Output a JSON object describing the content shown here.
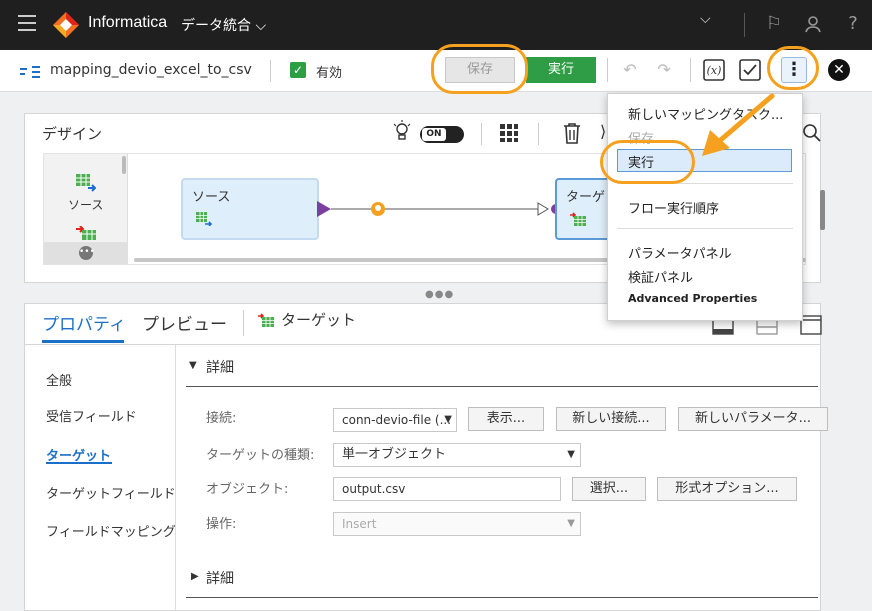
{
  "header": {
    "brand": "Informatica",
    "service": "データ統合 ⌵",
    "user_dropdown": "⌵"
  },
  "toolbar": {
    "mapping_name": "mapping_devio_excel_to_csv",
    "valid_label": "有効",
    "save_label": "保存",
    "run_label": "実行"
  },
  "design": {
    "title": "デザイン",
    "toggle_label": "ON",
    "palette_source": "ソース",
    "node_source": "ソース",
    "node_target": "ターゲット"
  },
  "menu": {
    "items": [
      "新しいマッピングタスク...",
      "保存",
      "実行",
      "フロー実行順序",
      "パラメータパネル",
      "検証パネル",
      "Advanced Properties"
    ]
  },
  "props": {
    "tab_properties": "プロパティ",
    "tab_preview": "プレビュー",
    "tab_target": "ターゲット",
    "side": [
      "全般",
      "受信フィールド",
      "ターゲット",
      "ターゲットフィールド",
      "フィールドマッピング"
    ],
    "section1": "詳細",
    "section2": "詳細",
    "connection_label": "接続:",
    "connection_value": "conn-devio-file (...",
    "show_btn": "表示...",
    "new_conn_btn": "新しい接続...",
    "new_param_btn": "新しいパラメータ...",
    "target_type_label": "ターゲットの種類:",
    "target_type_value": "単一オブジェクト",
    "object_label": "オブジェクト:",
    "object_value": "output.csv",
    "select_btn": "選択...",
    "format_btn": "形式オプション...",
    "operation_label": "操作:",
    "operation_value": "Insert"
  },
  "colors": {
    "accent": "#f5a11f",
    "run_green": "#2f9d45",
    "tab_blue": "#1a6fc9"
  }
}
